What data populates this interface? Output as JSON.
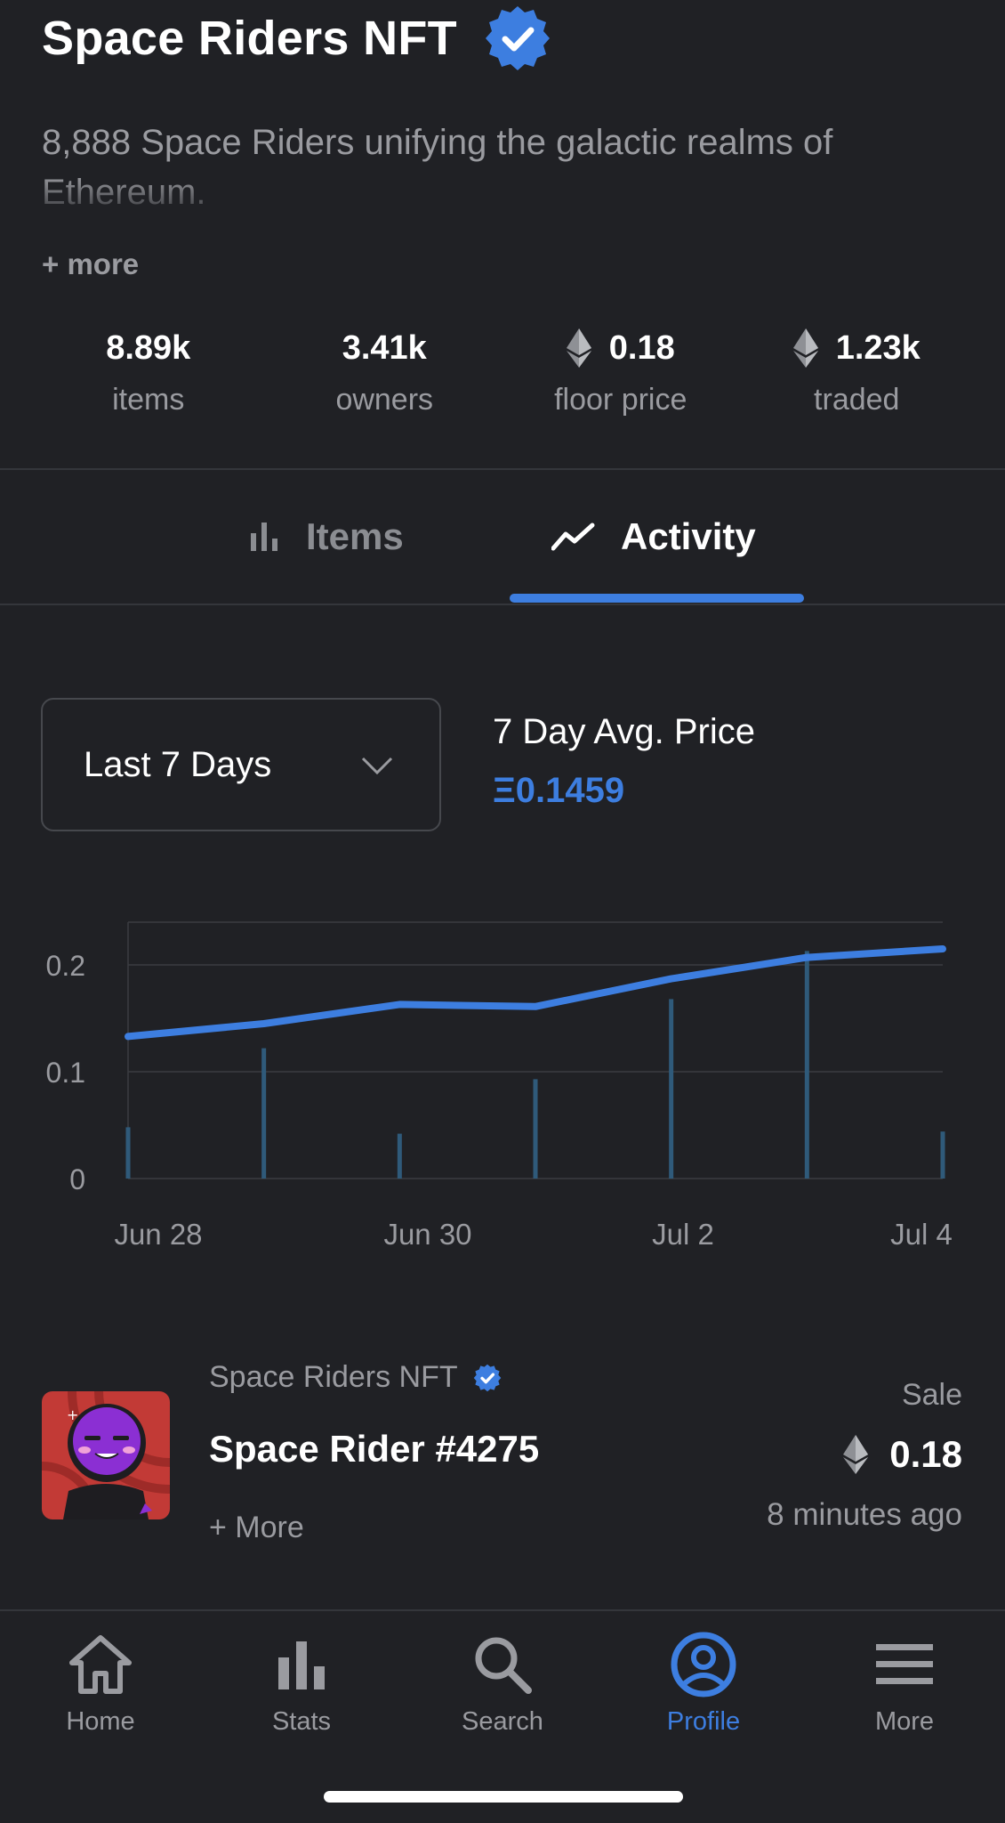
{
  "header": {
    "title": "Space Riders NFT",
    "verified": true,
    "description": "8,888 Space Riders unifying the galactic realms of Ethereum.",
    "more_label": "+ more"
  },
  "stats": [
    {
      "value": "8.89k",
      "label": "items",
      "icon": null
    },
    {
      "value": "3.41k",
      "label": "owners",
      "icon": null
    },
    {
      "value": "0.18",
      "label": "floor price",
      "icon": "ethereum-icon"
    },
    {
      "value": "1.23k",
      "label": "traded",
      "icon": "ethereum-icon"
    }
  ],
  "tabs": [
    {
      "label": "Items",
      "icon": "bar-chart-icon",
      "active": false
    },
    {
      "label": "Activity",
      "icon": "trend-line-icon",
      "active": true
    }
  ],
  "filter": {
    "selected": "Last 7 Days",
    "avg_label": "7 Day Avg. Price",
    "avg_value": "Ξ0.1459"
  },
  "chart_data": {
    "type": "line",
    "x": [
      "Jun 28",
      "Jun 29",
      "Jun 30",
      "Jul 1",
      "Jul 2",
      "Jul 3",
      "Jul 4"
    ],
    "xticks": [
      "Jun 28",
      "Jun 30",
      "Jul 2",
      "Jul 4"
    ],
    "yticks": [
      "0.2",
      "0.1",
      "0"
    ],
    "ylim": [
      0,
      0.24
    ],
    "grid": true,
    "series": [
      {
        "type": "line",
        "values": [
          0.133,
          0.145,
          0.163,
          0.161,
          0.187,
          0.207,
          0.215
        ]
      },
      {
        "type": "bar",
        "values": [
          0.048,
          0.122,
          0.042,
          0.093,
          0.168,
          0.213,
          0.044
        ]
      }
    ],
    "colors": {
      "line": "#3d7ee0",
      "bar": "#2f5a7a",
      "grid": "#3a3c41"
    }
  },
  "activity": {
    "collection": "Space Riders NFT",
    "name": "Space Rider #4275",
    "more": "+ More",
    "type": "Sale",
    "price": "0.18",
    "time": "8 minutes ago"
  },
  "nav": [
    {
      "label": "Home",
      "icon": "home-icon",
      "active": false
    },
    {
      "label": "Stats",
      "icon": "stats-icon",
      "active": false
    },
    {
      "label": "Search",
      "icon": "search-icon",
      "active": false
    },
    {
      "label": "Profile",
      "icon": "profile-icon",
      "active": true
    },
    {
      "label": "More",
      "icon": "menu-icon",
      "active": false
    }
  ],
  "colors": {
    "accent": "#3d7ee0",
    "background": "#202125",
    "muted": "#9a9ba0"
  }
}
